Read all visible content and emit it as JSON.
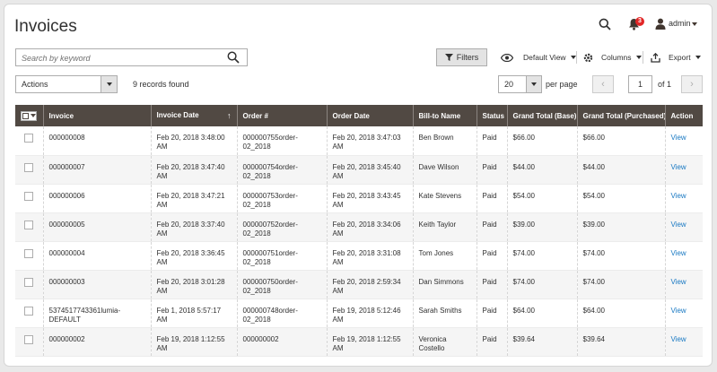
{
  "page": {
    "title": "Invoices"
  },
  "header": {
    "notifications_count": "3",
    "user_name": "admin"
  },
  "search": {
    "placeholder": "Search by keyword",
    "value": ""
  },
  "toolbar": {
    "filters_label": "Filters",
    "default_view_label": "Default View",
    "columns_label": "Columns",
    "export_label": "Export"
  },
  "actions": {
    "label": "Actions"
  },
  "records": {
    "text": "9 records found"
  },
  "pagination": {
    "per_page": "20",
    "per_page_label": "per page",
    "current_page": "1",
    "of_label": "of 1"
  },
  "table": {
    "columns": [
      "Invoice",
      "Invoice Date",
      "Order #",
      "Order Date",
      "Bill-to Name",
      "Status",
      "Grand Total (Base)",
      "Grand Total (Purchased)",
      "Action"
    ],
    "rows": [
      {
        "invoice": "000000008",
        "invoice_date": "Feb 20, 2018 3:48:00 AM",
        "order": "000000755order-02_2018",
        "order_date": "Feb 20, 2018 3:47:03 AM",
        "bill_to": "Ben Brown",
        "status": "Paid",
        "base": "$66.00",
        "purchased": "$66.00",
        "action": "View"
      },
      {
        "invoice": "000000007",
        "invoice_date": "Feb 20, 2018 3:47:40 AM",
        "order": "000000754order-02_2018",
        "order_date": "Feb 20, 2018 3:45:40 AM",
        "bill_to": "Dave Wilson",
        "status": "Paid",
        "base": "$44.00",
        "purchased": "$44.00",
        "action": "View"
      },
      {
        "invoice": "000000006",
        "invoice_date": "Feb 20, 2018 3:47:21 AM",
        "order": "000000753order-02_2018",
        "order_date": "Feb 20, 2018 3:43:45 AM",
        "bill_to": "Kate Stevens",
        "status": "Paid",
        "base": "$54.00",
        "purchased": "$54.00",
        "action": "View"
      },
      {
        "invoice": "000000005",
        "invoice_date": "Feb 20, 2018 3:37:40 AM",
        "order": "000000752order-02_2018",
        "order_date": "Feb 20, 2018 3:34:06 AM",
        "bill_to": "Keith Taylor",
        "status": "Paid",
        "base": "$39.00",
        "purchased": "$39.00",
        "action": "View"
      },
      {
        "invoice": "000000004",
        "invoice_date": "Feb 20, 2018 3:36:45 AM",
        "order": "000000751order-02_2018",
        "order_date": "Feb 20, 2018 3:31:08 AM",
        "bill_to": "Tom Jones",
        "status": "Paid",
        "base": "$74.00",
        "purchased": "$74.00",
        "action": "View"
      },
      {
        "invoice": "000000003",
        "invoice_date": "Feb 20, 2018 3:01:28 AM",
        "order": "000000750order-02_2018",
        "order_date": "Feb 20, 2018 2:59:34 AM",
        "bill_to": "Dan Simmons",
        "status": "Paid",
        "base": "$74.00",
        "purchased": "$74.00",
        "action": "View"
      },
      {
        "invoice": "5374517743361lumia-DEFAULT",
        "invoice_date": "Feb 1, 2018 5:57:17 AM",
        "order": "000000748order-02_2018",
        "order_date": "Feb 19, 2018 5:12:46 AM",
        "bill_to": "Sarah Smiths",
        "status": "Paid",
        "base": "$64.00",
        "purchased": "$64.00",
        "action": "View"
      },
      {
        "invoice": "000000002",
        "invoice_date": "Feb 19, 2018 1:12:55 AM",
        "order": "000000002",
        "order_date": "Feb 19, 2018 1:12:55 AM",
        "bill_to": "Veronica Costello",
        "status": "Paid",
        "base": "$39.64",
        "purchased": "$39.64",
        "action": "View"
      }
    ]
  },
  "colors": {
    "header_bg": "#514943",
    "link": "#1979c3",
    "badge": "#e22626"
  }
}
